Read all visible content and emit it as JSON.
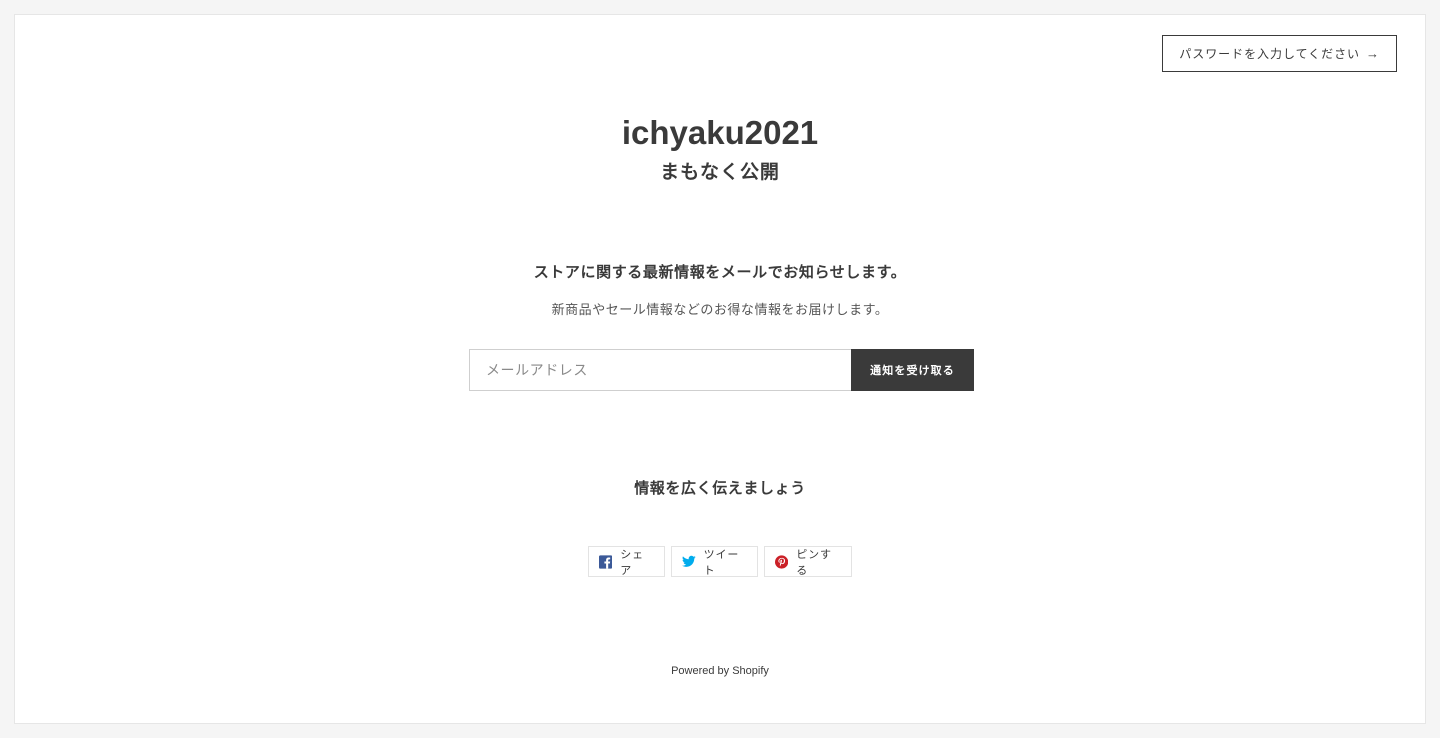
{
  "header": {
    "password_button": "パスワードを入力してください",
    "password_arrow": "→",
    "store_name": "ichyaku2021",
    "status": "まもなく公開"
  },
  "newsletter": {
    "heading": "ストアに関する最新情報をメールでお知らせします。",
    "subheading": "新商品やセール情報などのお得な情報をお届けします。",
    "email_placeholder": "メールアドレス",
    "email_value": "",
    "submit_label": "通知を受け取る"
  },
  "share": {
    "heading": "情報を広く伝えましょう",
    "buttons": [
      {
        "label": "シェア",
        "icon": "facebook-icon",
        "color": "#3b5998"
      },
      {
        "label": "ツイート",
        "icon": "twitter-icon",
        "color": "#00aced"
      },
      {
        "label": "ピンする",
        "icon": "pinterest-icon",
        "color": "#cb2027"
      }
    ]
  },
  "footer": {
    "powered_by": "Powered by Shopify"
  },
  "colors": {
    "text": "#3a3a3a",
    "button_dark": "#3a3a3a",
    "background": "#f5f5f5"
  }
}
